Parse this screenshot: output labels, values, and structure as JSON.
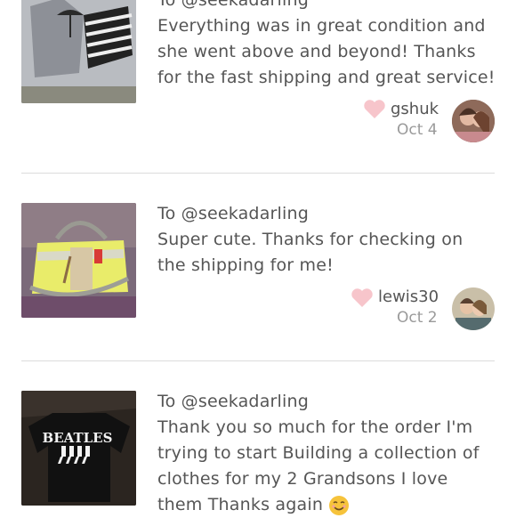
{
  "reviews": [
    {
      "to": "To @seekadarling",
      "text": "Everything was in great condition and she went above and beyond! Thanks for the fast shipping and great service!",
      "user": "gshuk",
      "date": "Oct 4",
      "thumb_icon": "clothing-photo",
      "avatar_icon": "couple-avatar"
    },
    {
      "to": "To @seekadarling",
      "text": "Super cute. Thanks for checking on the shipping for me!",
      "user": "lewis30",
      "date": "Oct 2",
      "thumb_icon": "handbag-photo",
      "avatar_icon": "couple-avatar"
    },
    {
      "to": "To @seekadarling",
      "text": "Thank you so much for the order I'm trying to start Building a collection of clothes for my 2 Grandsons I love them Thanks again",
      "thumb_icon": "beatles-shirt-photo",
      "thumb_text": "BEATLES",
      "emoji_icon": "smiling-emoji"
    }
  ],
  "colors": {
    "heart": "#f7c5cb",
    "divider": "#dcdcdc",
    "text": "#555555",
    "date": "#9a9a9a"
  }
}
